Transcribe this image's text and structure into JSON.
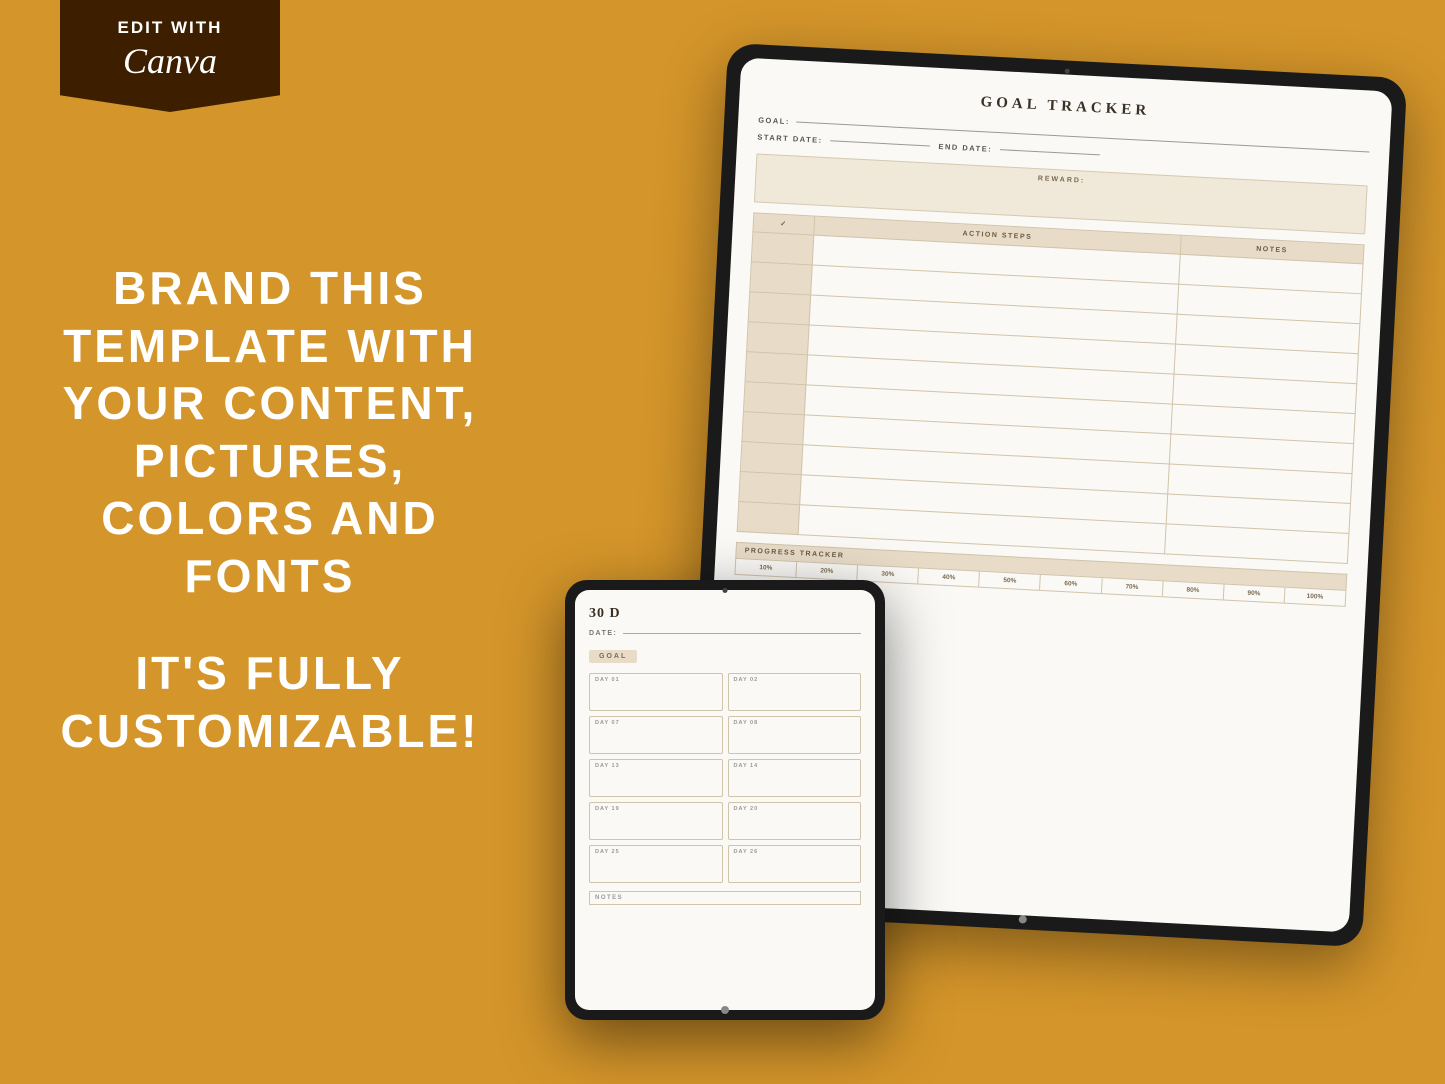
{
  "background_color": "#D4952A",
  "banner": {
    "edit_with_label": "EDIT WITH",
    "canva_label": "Canva"
  },
  "left_text": {
    "line1": "BRAND THIS",
    "line2": "TEMPLATE WITH",
    "line3": "YOUR CONTENT,",
    "line4": "PICTURES,",
    "line5": "COLORS AND",
    "line6": "FONTS",
    "line7": "IT'S FULLY",
    "line8": "CUSTOMIZABLE!"
  },
  "goal_tracker": {
    "title": "GOAL TRACKER",
    "goal_label": "GOAL:",
    "start_date_label": "START DATE:",
    "end_date_label": "END DATE:",
    "reward_label": "REWARD:",
    "table_headers": {
      "check": "✓",
      "action_steps": "ACTION STEPS",
      "notes": "NOTES"
    },
    "table_rows": 10,
    "progress_label": "PROGRESS TRACKER",
    "progress_cells": [
      "10%",
      "20%",
      "30%",
      "40%",
      "50%",
      "60%",
      "70%",
      "80%",
      "90%",
      "100%"
    ]
  },
  "thirty_day": {
    "title": "30 D",
    "date_label": "DATE:",
    "goal_badge": "GOAL",
    "days": [
      {
        "label": "DAY 01"
      },
      {
        "label": "DAY 02"
      },
      {
        "label": "DAY 07"
      },
      {
        "label": "DAY 08"
      },
      {
        "label": "DAY 13"
      },
      {
        "label": "DAY 14"
      },
      {
        "label": "DAY 19"
      },
      {
        "label": "DAY 20"
      },
      {
        "label": "DAY 25"
      },
      {
        "label": "DAY 26"
      }
    ],
    "notes_label": "NOTES"
  }
}
